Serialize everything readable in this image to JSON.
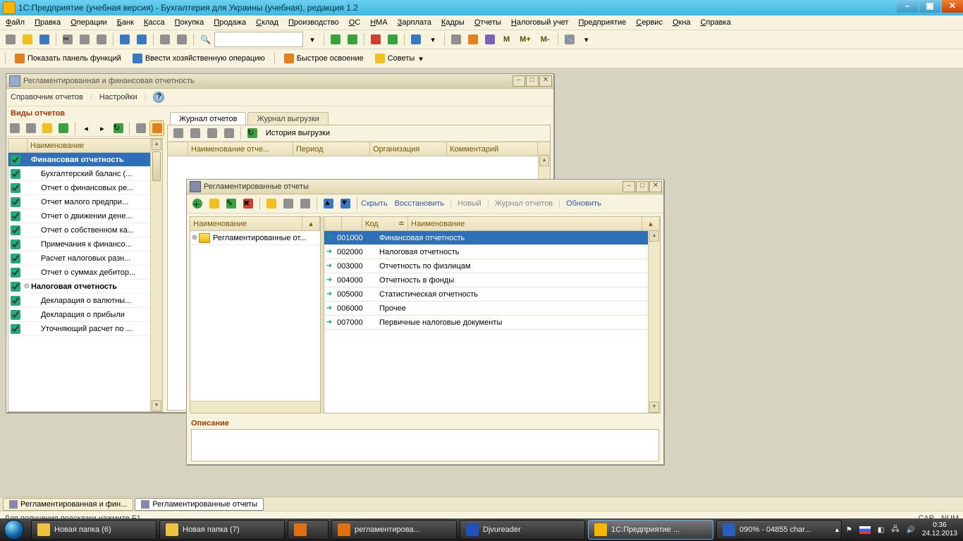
{
  "title": "1С:Предприятие (учебная версия) - Бухгалтерия для Украины (учебная), редакция 1.2",
  "menu": [
    "Файл",
    "Правка",
    "Операции",
    "Банк",
    "Касса",
    "Покупка",
    "Продажа",
    "Склад",
    "Производство",
    "ОС",
    "НМА",
    "Зарплата",
    "Кадры",
    "Отчеты",
    "Налоговый учет",
    "Предприятие",
    "Сервис",
    "Окна",
    "Справка"
  ],
  "toolbar2_text": {
    "m": "М",
    "mplus": "М+",
    "mminus": "М-"
  },
  "actionbar": {
    "panel_funcs": "Показать панель функций",
    "biz_op": "Ввести хозяйственную операцию",
    "fast": "Быстрое освоение",
    "tips": "Советы"
  },
  "win1": {
    "title": "Регламентированная и финансовая отчетность",
    "subtool": [
      "Справочник отчетов",
      "Настройки"
    ],
    "section": "Виды отчетов",
    "col": "Наименование",
    "tree": [
      {
        "sel": true,
        "exp": "⊖",
        "bold": true,
        "label": "Финансовая  отчетность"
      },
      {
        "label": "Бухгалтерский баланс (..."
      },
      {
        "label": "Отчет о финансовых ре..."
      },
      {
        "label": "Отчет малого предпри..."
      },
      {
        "label": "Отчет о движении дене..."
      },
      {
        "label": "Отчет о собственном ка..."
      },
      {
        "label": "Примечания к финансо..."
      },
      {
        "label": "Расчет налоговых разн..."
      },
      {
        "label": "Отчет о суммах дебитор..."
      },
      {
        "exp": "⊖",
        "bold": true,
        "label": "Налоговая отчетность"
      },
      {
        "label": "Декларация о валютны..."
      },
      {
        "label": "Декларация о прибыли"
      },
      {
        "label": "Уточняющий расчет по ..."
      }
    ],
    "tabs": [
      "Журнал отчетов",
      "Журнал выгрузки"
    ],
    "journal_tool": "История выгрузки",
    "journal_cols": [
      "",
      "Наименование отче...",
      "Период",
      "Организация",
      "Комментарий"
    ]
  },
  "win2": {
    "title": "Регламентированные отчеты",
    "tool_links": {
      "hide": "Скрыть",
      "restore": "Восстановить",
      "new": "Новый",
      "journal": "Журнал отчетов",
      "refresh": "Обновить"
    },
    "left_col": "Наименование",
    "left_tree": [
      {
        "exp": "⊕",
        "label": "Регламентированные от..."
      }
    ],
    "right_cols": {
      "code": "Код",
      "name": "Наименование"
    },
    "rows": [
      {
        "code": "001000",
        "name": "Финансовая  отчетность",
        "sel": true
      },
      {
        "code": "002000",
        "name": "Налоговая отчетность"
      },
      {
        "code": "003000",
        "name": "Отчетность по физлицам"
      },
      {
        "code": "004000",
        "name": "Отчетность в фонды"
      },
      {
        "code": "005000",
        "name": "Статистическая отчетность"
      },
      {
        "code": "006000",
        "name": "Прочее"
      },
      {
        "code": "007000",
        "name": "Первичные налоговые документы"
      }
    ],
    "desc": "Описание"
  },
  "doctabs": [
    {
      "label": "Регламентированная и фин...",
      "active": false
    },
    {
      "label": "Регламентированные отчеты",
      "active": true
    }
  ],
  "status": {
    "hint": "Для получения подсказки нажмите F1",
    "cap": "CAP",
    "num": "NUM"
  },
  "taskbar": [
    {
      "label": "Новая папка (6)",
      "color": "#f0c040"
    },
    {
      "label": "Новая папка (7)",
      "color": "#f0c040"
    },
    {
      "label": "",
      "color": "#e07010",
      "w": 40
    },
    {
      "label": "регламентирова...",
      "color": "#e07010"
    },
    {
      "label": "Djvureader",
      "color": "#2050c0"
    },
    {
      "label": "1С:Предприятие ...",
      "color": "#f7b500",
      "active": true
    },
    {
      "label": "090% - 04855 char...",
      "color": "#2a5fbe"
    }
  ],
  "clock": {
    "time": "0:36",
    "date": "24.12.2013"
  }
}
